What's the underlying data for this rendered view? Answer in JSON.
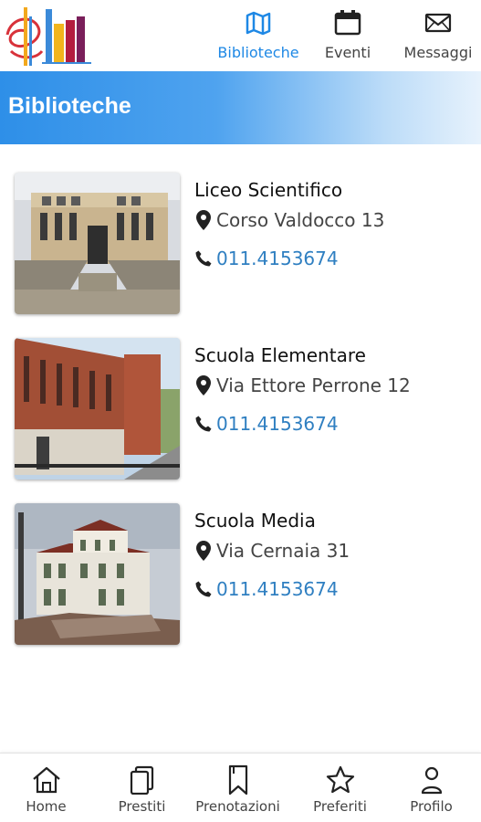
{
  "header": {
    "tabs": [
      {
        "label": "Biblioteche",
        "icon": "map-icon",
        "active": true
      },
      {
        "label": "Eventi",
        "icon": "calendar-icon",
        "active": false
      },
      {
        "label": "Messaggi",
        "icon": "envelope-icon",
        "active": false
      }
    ]
  },
  "page": {
    "title": "Biblioteche"
  },
  "libraries": [
    {
      "name": "Liceo Scientifico",
      "address": "Corso Valdocco 13",
      "phone": "011.4153674"
    },
    {
      "name": "Scuola Elementare",
      "address": "Via Ettore Perrone 12",
      "phone": "011.4153674"
    },
    {
      "name": "Scuola Media",
      "address": "Via Cernaia 31",
      "phone": "011.4153674"
    }
  ],
  "bottom_nav": [
    {
      "label": "Home",
      "icon": "home-icon"
    },
    {
      "label": "Prestiti",
      "icon": "books-icon"
    },
    {
      "label": "Prenotazioni",
      "icon": "bookmark-icon"
    },
    {
      "label": "Preferiti",
      "icon": "star-icon"
    },
    {
      "label": "Profilo",
      "icon": "user-icon"
    }
  ],
  "colors": {
    "accent": "#1e88e5",
    "phone_link": "#2f7fc1",
    "title_bar_start": "#2e8fe8"
  }
}
